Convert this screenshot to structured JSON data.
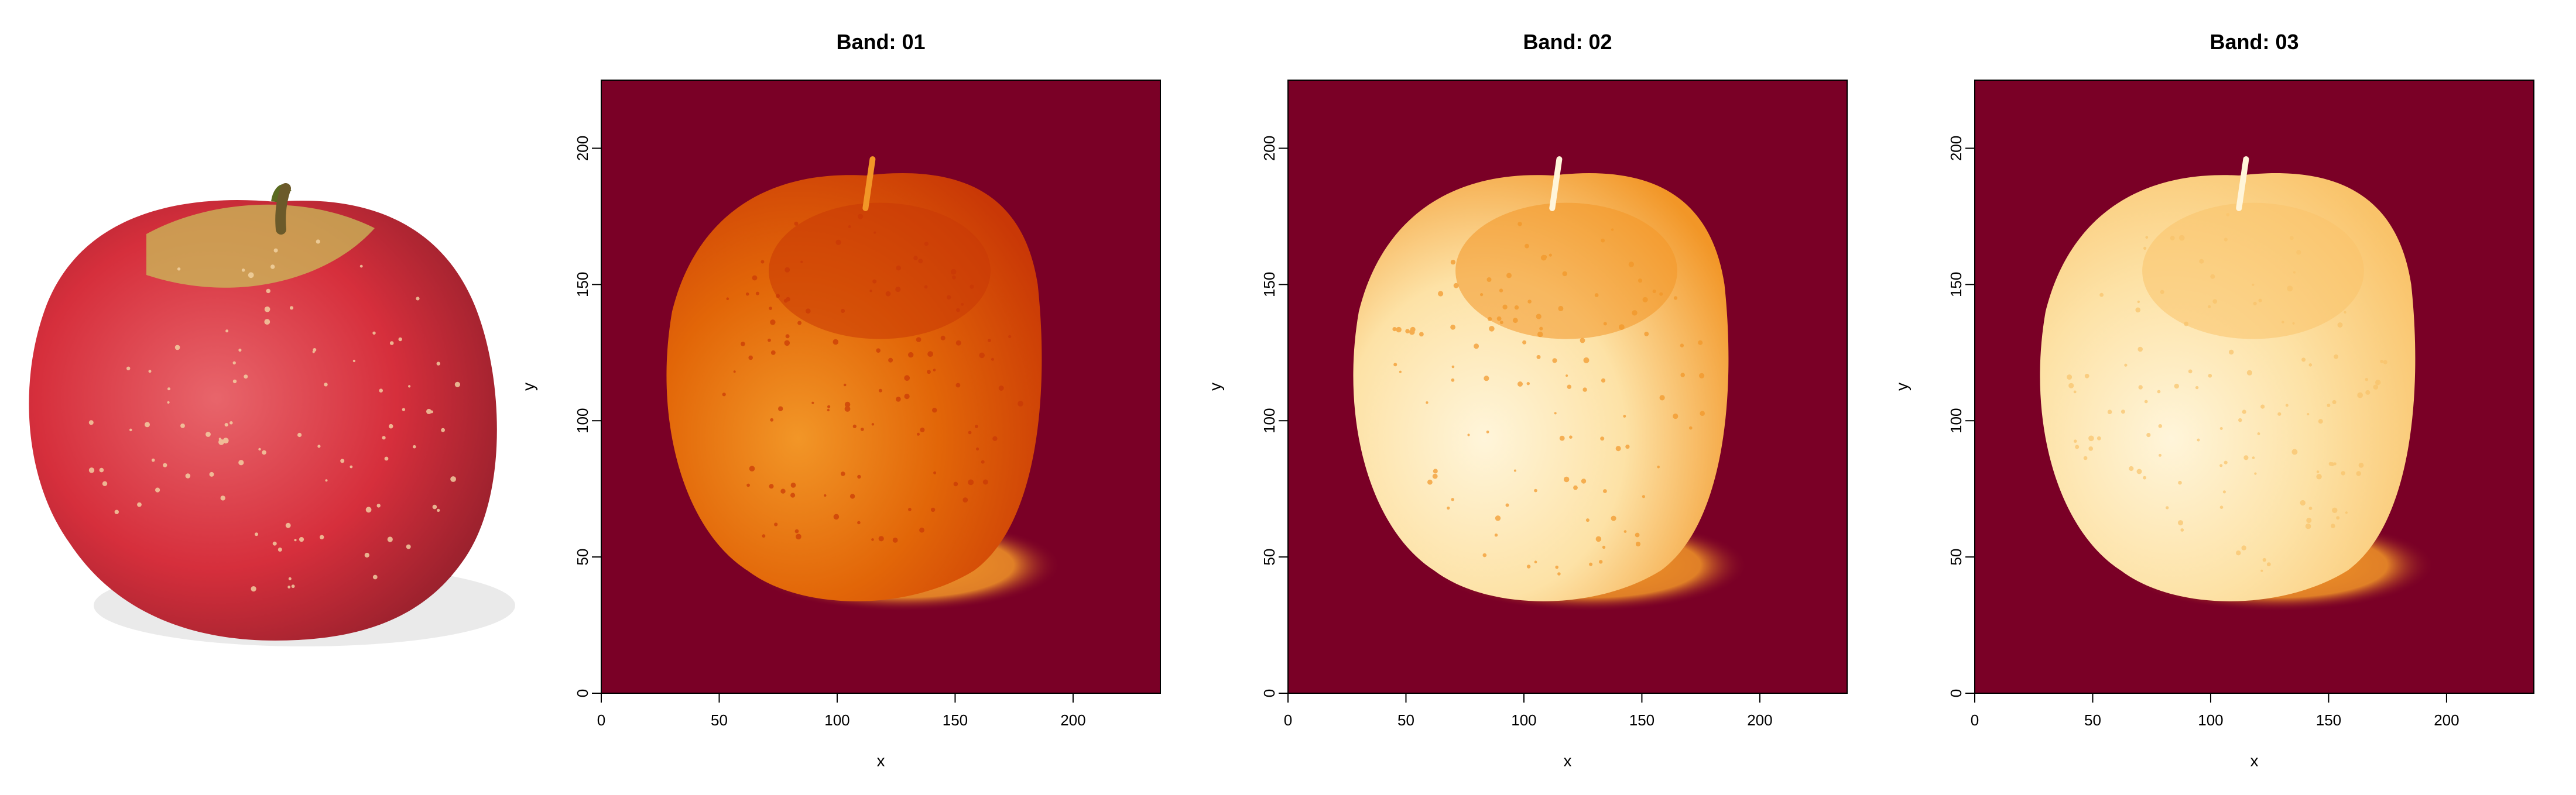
{
  "colors": {
    "background_fill": "#7a0026",
    "ramp": [
      "#7a0026",
      "#a3150e",
      "#c93806",
      "#e26608",
      "#f29627",
      "#f9c36a",
      "#fde2a6",
      "#fff5da"
    ],
    "apple_red": "#d62f3c",
    "apple_green": "#b9c24a",
    "photo_background": "#ffffff"
  },
  "photo": {
    "icon": "apple-photo",
    "label": ""
  },
  "chart_data": [
    {
      "type": "heatmap",
      "title": "Band: 01",
      "xlabel": "x",
      "ylabel": "y",
      "xlim": [
        0,
        237
      ],
      "ylim": [
        0,
        225
      ],
      "xticks": [
        0,
        50,
        100,
        150,
        200
      ],
      "yticks": [
        0,
        50,
        100,
        150,
        200
      ],
      "grid": false,
      "legend": "none",
      "values_description_levels": {
        "background": 0,
        "apple_body": 3,
        "apple_lit_side": 4,
        "apple_shadow_side": 2,
        "ground_shadow": 4
      }
    },
    {
      "type": "heatmap",
      "title": "Band: 02",
      "xlabel": "x",
      "ylabel": "y",
      "xlim": [
        0,
        237
      ],
      "ylim": [
        0,
        225
      ],
      "xticks": [
        0,
        50,
        100,
        150,
        200
      ],
      "yticks": [
        0,
        50,
        100,
        150,
        200
      ],
      "grid": false,
      "legend": "none",
      "values_description_levels": {
        "background": 0,
        "apple_body": 6,
        "apple_lit_side": 7,
        "apple_shadow_side": 4,
        "ground_shadow": 4
      }
    },
    {
      "type": "heatmap",
      "title": "Band: 03",
      "xlabel": "x",
      "ylabel": "y",
      "xlim": [
        0,
        237
      ],
      "ylim": [
        0,
        225
      ],
      "xticks": [
        0,
        50,
        100,
        150,
        200
      ],
      "yticks": [
        0,
        50,
        100,
        150,
        200
      ],
      "grid": false,
      "legend": "none",
      "values_description_levels": {
        "background": 0,
        "apple_body": 6,
        "apple_lit_side": 7,
        "apple_shadow_side": 5,
        "ground_shadow": 4
      }
    }
  ]
}
